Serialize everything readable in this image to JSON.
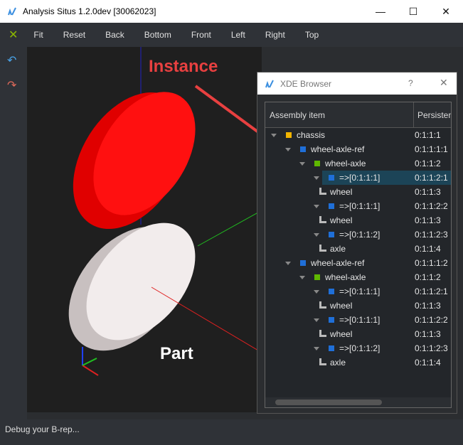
{
  "window": {
    "title": "Analysis Situs 1.2.0dev [30062023]"
  },
  "toolbar": {
    "items": [
      "Fit",
      "Reset",
      "Back",
      "Bottom",
      "Front",
      "Left",
      "Right",
      "Top"
    ]
  },
  "viewport": {
    "annotation_instance": "Instance",
    "annotation_part": "Part"
  },
  "status": "Debug your B-rep...",
  "xde": {
    "title": "XDE Browser",
    "help": "?",
    "columns": [
      "Assembly item",
      "Persistent"
    ],
    "rows": [
      {
        "level": 0,
        "label": "chassis",
        "id": "0:1:1:1",
        "icon": "#f2b400",
        "expand": true
      },
      {
        "level": 1,
        "label": "wheel-axle-ref",
        "id": "0:1:1:1:1",
        "icon": "#1f6fd8",
        "expand": true
      },
      {
        "level": 2,
        "label": "wheel-axle",
        "id": "0:1:1:2",
        "icon": "#5fb800",
        "expand": true
      },
      {
        "level": 3,
        "label": "=>[0:1:1:1]",
        "id": "0:1:1:2:1",
        "icon": "#1f6fd8",
        "expand": true,
        "selected": true
      },
      {
        "level": 4,
        "label": "wheel",
        "id": "0:1:1:3",
        "icon": "leaf"
      },
      {
        "level": 3,
        "label": "=>[0:1:1:1]",
        "id": "0:1:1:2:2",
        "icon": "#1f6fd8",
        "expand": true
      },
      {
        "level": 4,
        "label": "wheel",
        "id": "0:1:1:3",
        "icon": "leaf"
      },
      {
        "level": 3,
        "label": "=>[0:1:1:2]",
        "id": "0:1:1:2:3",
        "icon": "#1f6fd8",
        "expand": true
      },
      {
        "level": 4,
        "label": "axle",
        "id": "0:1:1:4",
        "icon": "leaf"
      },
      {
        "level": 1,
        "label": "wheel-axle-ref",
        "id": "0:1:1:1:2",
        "icon": "#1f6fd8",
        "expand": true
      },
      {
        "level": 2,
        "label": "wheel-axle",
        "id": "0:1:1:2",
        "icon": "#5fb800",
        "expand": true
      },
      {
        "level": 3,
        "label": "=>[0:1:1:1]",
        "id": "0:1:1:2:1",
        "icon": "#1f6fd8",
        "expand": true
      },
      {
        "level": 4,
        "label": "wheel",
        "id": "0:1:1:3",
        "icon": "leaf"
      },
      {
        "level": 3,
        "label": "=>[0:1:1:1]",
        "id": "0:1:1:2:2",
        "icon": "#1f6fd8",
        "expand": true
      },
      {
        "level": 4,
        "label": "wheel",
        "id": "0:1:1:3",
        "icon": "leaf"
      },
      {
        "level": 3,
        "label": "=>[0:1:1:2]",
        "id": "0:1:1:2:3",
        "icon": "#1f6fd8",
        "expand": true
      },
      {
        "level": 4,
        "label": "axle",
        "id": "0:1:1:4",
        "icon": "leaf"
      }
    ]
  }
}
